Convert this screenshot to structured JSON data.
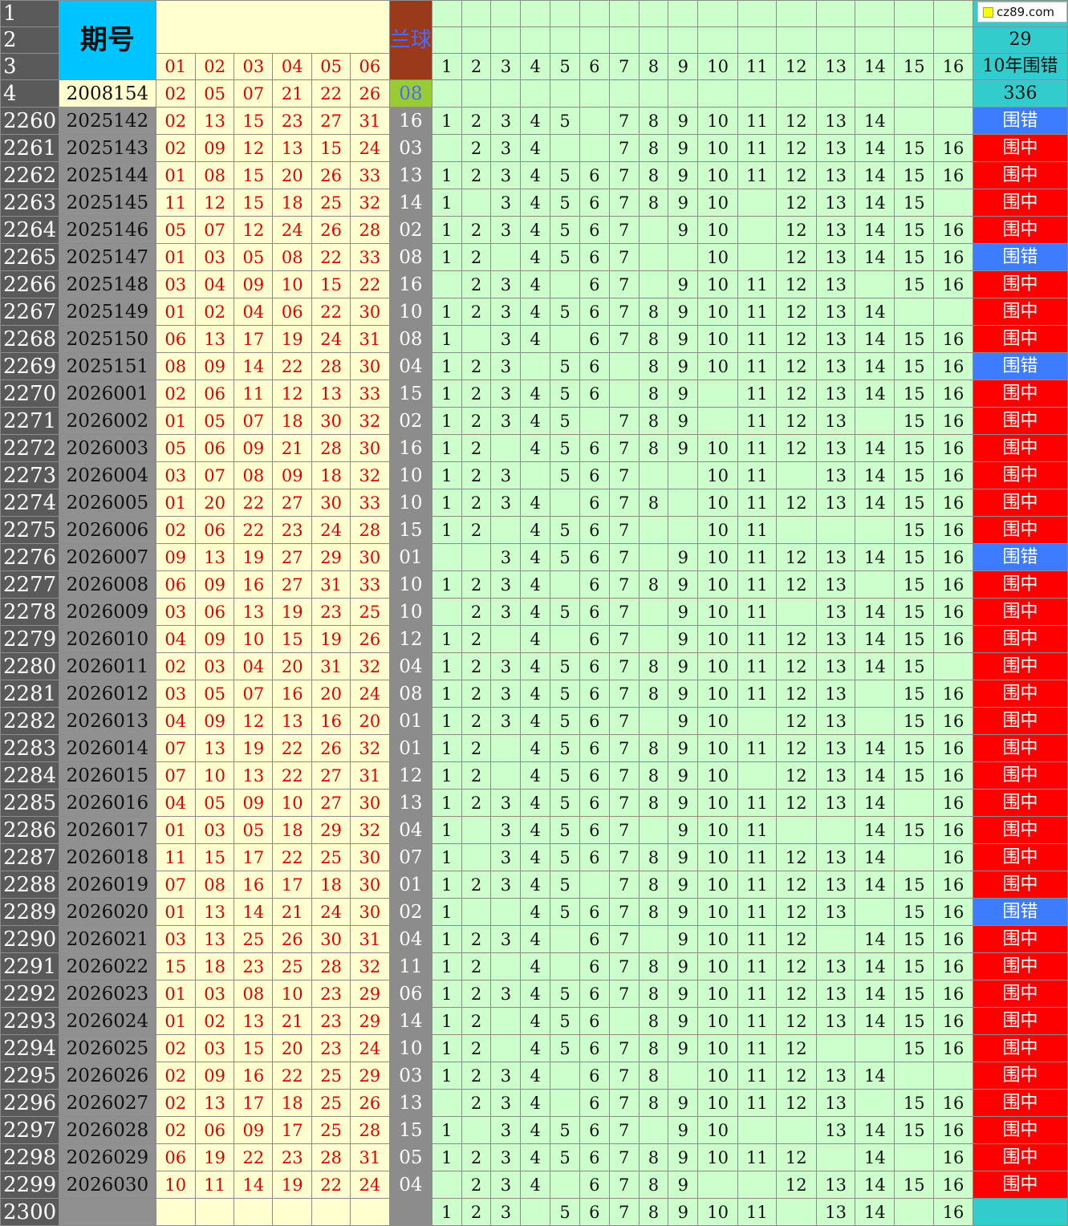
{
  "header": {
    "row_labels": [
      "1",
      "2",
      "3",
      "4"
    ],
    "qihao": "期号",
    "blue_label": "兰球",
    "red_cols": [
      "01",
      "02",
      "03",
      "04",
      "05",
      "06"
    ],
    "blue_digits": [
      "1",
      "2",
      "3",
      "4",
      "5",
      "6",
      "7",
      "8",
      "9",
      "10",
      "11",
      "12",
      "13",
      "14",
      "15",
      "16"
    ],
    "stat_row2": "29",
    "stat_row3": "10年围错",
    "first_issue": "2008154",
    "first_reds": [
      "02",
      "05",
      "07",
      "21",
      "22",
      "26"
    ],
    "first_blue": "08",
    "stat_row4": "336"
  },
  "watermark": "cz89.com",
  "colors": {
    "hit": "#ff0000",
    "miss": "#3d7bff",
    "stat": "#33cccc",
    "green": "#ccffcc",
    "yellow": "#ffffd0"
  },
  "rows": [
    {
      "n": "2260",
      "issue": "2025142",
      "reds": [
        "02",
        "13",
        "15",
        "23",
        "27",
        "31"
      ],
      "blue": "16",
      "digits": [
        "1",
        "2",
        "3",
        "4",
        "5",
        "",
        "7",
        "8",
        "9",
        "10",
        "11",
        "12",
        "13",
        "14",
        "",
        ""
      ],
      "result": "围错",
      "hit": false
    },
    {
      "n": "2261",
      "issue": "2025143",
      "reds": [
        "02",
        "09",
        "12",
        "13",
        "15",
        "24"
      ],
      "blue": "03",
      "digits": [
        "",
        "2",
        "3",
        "4",
        "",
        "",
        "7",
        "8",
        "9",
        "10",
        "11",
        "12",
        "13",
        "14",
        "15",
        "16"
      ],
      "result": "围中",
      "hit": true
    },
    {
      "n": "2262",
      "issue": "2025144",
      "reds": [
        "01",
        "08",
        "15",
        "20",
        "26",
        "33"
      ],
      "blue": "13",
      "digits": [
        "1",
        "2",
        "3",
        "4",
        "5",
        "6",
        "7",
        "8",
        "9",
        "10",
        "11",
        "12",
        "13",
        "14",
        "15",
        "16"
      ],
      "result": "围中",
      "hit": true
    },
    {
      "n": "2263",
      "issue": "2025145",
      "reds": [
        "11",
        "12",
        "15",
        "18",
        "25",
        "32"
      ],
      "blue": "14",
      "digits": [
        "1",
        "",
        "3",
        "4",
        "5",
        "6",
        "7",
        "8",
        "9",
        "10",
        "",
        "12",
        "13",
        "14",
        "15",
        ""
      ],
      "result": "围中",
      "hit": true
    },
    {
      "n": "2264",
      "issue": "2025146",
      "reds": [
        "05",
        "07",
        "12",
        "24",
        "26",
        "28"
      ],
      "blue": "02",
      "digits": [
        "1",
        "2",
        "3",
        "4",
        "5",
        "6",
        "7",
        "",
        "9",
        "10",
        "",
        "12",
        "13",
        "14",
        "15",
        "16"
      ],
      "result": "围中",
      "hit": true
    },
    {
      "n": "2265",
      "issue": "2025147",
      "reds": [
        "01",
        "03",
        "05",
        "08",
        "22",
        "33"
      ],
      "blue": "08",
      "digits": [
        "1",
        "2",
        "",
        "4",
        "5",
        "6",
        "7",
        "",
        "",
        "10",
        "",
        "12",
        "13",
        "14",
        "15",
        "16"
      ],
      "result": "围错",
      "hit": false
    },
    {
      "n": "2266",
      "issue": "2025148",
      "reds": [
        "03",
        "04",
        "09",
        "10",
        "15",
        "22"
      ],
      "blue": "16",
      "digits": [
        "",
        "2",
        "3",
        "4",
        "",
        "6",
        "7",
        "",
        "9",
        "10",
        "11",
        "12",
        "13",
        "",
        "15",
        "16"
      ],
      "result": "围中",
      "hit": true
    },
    {
      "n": "2267",
      "issue": "2025149",
      "reds": [
        "01",
        "02",
        "04",
        "06",
        "22",
        "30"
      ],
      "blue": "10",
      "digits": [
        "1",
        "2",
        "3",
        "4",
        "5",
        "6",
        "7",
        "8",
        "9",
        "10",
        "11",
        "12",
        "13",
        "14",
        "",
        ""
      ],
      "result": "围中",
      "hit": true
    },
    {
      "n": "2268",
      "issue": "2025150",
      "reds": [
        "06",
        "13",
        "17",
        "19",
        "24",
        "31"
      ],
      "blue": "08",
      "digits": [
        "1",
        "",
        "3",
        "4",
        "",
        "6",
        "7",
        "8",
        "9",
        "10",
        "11",
        "12",
        "13",
        "14",
        "15",
        "16"
      ],
      "result": "围中",
      "hit": true
    },
    {
      "n": "2269",
      "issue": "2025151",
      "reds": [
        "08",
        "09",
        "14",
        "22",
        "28",
        "30"
      ],
      "blue": "04",
      "digits": [
        "1",
        "2",
        "3",
        "",
        "5",
        "6",
        "",
        "8",
        "9",
        "10",
        "11",
        "12",
        "13",
        "14",
        "15",
        "16"
      ],
      "result": "围错",
      "hit": false
    },
    {
      "n": "2270",
      "issue": "2026001",
      "reds": [
        "02",
        "06",
        "11",
        "12",
        "13",
        "33"
      ],
      "blue": "15",
      "digits": [
        "1",
        "2",
        "3",
        "4",
        "5",
        "6",
        "",
        "8",
        "9",
        "",
        "11",
        "12",
        "13",
        "14",
        "15",
        "16"
      ],
      "result": "围中",
      "hit": true
    },
    {
      "n": "2271",
      "issue": "2026002",
      "reds": [
        "01",
        "05",
        "07",
        "18",
        "30",
        "32"
      ],
      "blue": "02",
      "digits": [
        "1",
        "2",
        "3",
        "4",
        "5",
        "",
        "7",
        "8",
        "9",
        "",
        "11",
        "12",
        "13",
        "",
        "15",
        "16"
      ],
      "result": "围中",
      "hit": true
    },
    {
      "n": "2272",
      "issue": "2026003",
      "reds": [
        "05",
        "06",
        "09",
        "21",
        "28",
        "30"
      ],
      "blue": "16",
      "digits": [
        "1",
        "2",
        "",
        "4",
        "5",
        "6",
        "7",
        "8",
        "9",
        "10",
        "11",
        "12",
        "13",
        "14",
        "15",
        "16"
      ],
      "result": "围中",
      "hit": true
    },
    {
      "n": "2273",
      "issue": "2026004",
      "reds": [
        "03",
        "07",
        "08",
        "09",
        "18",
        "32"
      ],
      "blue": "10",
      "digits": [
        "1",
        "2",
        "3",
        "",
        "5",
        "6",
        "7",
        "",
        "",
        "10",
        "11",
        "",
        "13",
        "14",
        "15",
        "16"
      ],
      "result": "围中",
      "hit": true
    },
    {
      "n": "2274",
      "issue": "2026005",
      "reds": [
        "01",
        "20",
        "22",
        "27",
        "30",
        "33"
      ],
      "blue": "10",
      "digits": [
        "1",
        "2",
        "3",
        "4",
        "",
        "6",
        "7",
        "8",
        "",
        "10",
        "11",
        "12",
        "13",
        "14",
        "15",
        "16"
      ],
      "result": "围中",
      "hit": true
    },
    {
      "n": "2275",
      "issue": "2026006",
      "reds": [
        "02",
        "06",
        "22",
        "23",
        "24",
        "28"
      ],
      "blue": "15",
      "digits": [
        "1",
        "2",
        "",
        "4",
        "5",
        "6",
        "7",
        "",
        "",
        "10",
        "11",
        "",
        "",
        "",
        "15",
        "16"
      ],
      "result": "围中",
      "hit": true
    },
    {
      "n": "2276",
      "issue": "2026007",
      "reds": [
        "09",
        "13",
        "19",
        "27",
        "29",
        "30"
      ],
      "blue": "01",
      "digits": [
        "",
        "",
        "3",
        "4",
        "5",
        "6",
        "7",
        "",
        "9",
        "10",
        "11",
        "12",
        "13",
        "14",
        "15",
        "16"
      ],
      "result": "围错",
      "hit": false
    },
    {
      "n": "2277",
      "issue": "2026008",
      "reds": [
        "06",
        "09",
        "16",
        "27",
        "31",
        "33"
      ],
      "blue": "10",
      "digits": [
        "1",
        "2",
        "3",
        "4",
        "",
        "6",
        "7",
        "8",
        "9",
        "10",
        "11",
        "12",
        "13",
        "",
        "15",
        "16"
      ],
      "result": "围中",
      "hit": true
    },
    {
      "n": "2278",
      "issue": "2026009",
      "reds": [
        "03",
        "06",
        "13",
        "19",
        "23",
        "25"
      ],
      "blue": "10",
      "digits": [
        "",
        "2",
        "3",
        "4",
        "5",
        "6",
        "7",
        "",
        "9",
        "10",
        "11",
        "",
        "13",
        "14",
        "15",
        "16"
      ],
      "result": "围中",
      "hit": true
    },
    {
      "n": "2279",
      "issue": "2026010",
      "reds": [
        "04",
        "09",
        "10",
        "15",
        "19",
        "26"
      ],
      "blue": "12",
      "digits": [
        "1",
        "2",
        "",
        "4",
        "",
        "6",
        "7",
        "",
        "9",
        "10",
        "11",
        "12",
        "13",
        "14",
        "15",
        "16"
      ],
      "result": "围中",
      "hit": true
    },
    {
      "n": "2280",
      "issue": "2026011",
      "reds": [
        "02",
        "03",
        "04",
        "20",
        "31",
        "32"
      ],
      "blue": "04",
      "digits": [
        "1",
        "2",
        "3",
        "4",
        "5",
        "6",
        "7",
        "8",
        "9",
        "10",
        "11",
        "12",
        "13",
        "14",
        "15",
        ""
      ],
      "result": "围中",
      "hit": true
    },
    {
      "n": "2281",
      "issue": "2026012",
      "reds": [
        "03",
        "05",
        "07",
        "16",
        "20",
        "24"
      ],
      "blue": "08",
      "digits": [
        "1",
        "2",
        "3",
        "4",
        "5",
        "6",
        "7",
        "8",
        "9",
        "10",
        "11",
        "12",
        "13",
        "",
        "15",
        "16"
      ],
      "result": "围中",
      "hit": true
    },
    {
      "n": "2282",
      "issue": "2026013",
      "reds": [
        "04",
        "09",
        "12",
        "13",
        "16",
        "20"
      ],
      "blue": "01",
      "digits": [
        "1",
        "2",
        "3",
        "4",
        "5",
        "6",
        "7",
        "",
        "9",
        "10",
        "",
        "12",
        "13",
        "",
        "15",
        "16"
      ],
      "result": "围中",
      "hit": true
    },
    {
      "n": "2283",
      "issue": "2026014",
      "reds": [
        "07",
        "13",
        "19",
        "22",
        "26",
        "32"
      ],
      "blue": "01",
      "digits": [
        "1",
        "2",
        "",
        "4",
        "5",
        "6",
        "7",
        "8",
        "9",
        "10",
        "11",
        "12",
        "13",
        "14",
        "15",
        "16"
      ],
      "result": "围中",
      "hit": true
    },
    {
      "n": "2284",
      "issue": "2026015",
      "reds": [
        "07",
        "10",
        "13",
        "22",
        "27",
        "31"
      ],
      "blue": "12",
      "digits": [
        "1",
        "2",
        "",
        "4",
        "5",
        "6",
        "7",
        "8",
        "9",
        "10",
        "",
        "12",
        "13",
        "14",
        "15",
        "16"
      ],
      "result": "围中",
      "hit": true
    },
    {
      "n": "2285",
      "issue": "2026016",
      "reds": [
        "04",
        "05",
        "09",
        "10",
        "27",
        "30"
      ],
      "blue": "13",
      "digits": [
        "1",
        "2",
        "3",
        "4",
        "5",
        "6",
        "7",
        "8",
        "9",
        "10",
        "11",
        "12",
        "13",
        "14",
        "",
        "16"
      ],
      "result": "围中",
      "hit": true
    },
    {
      "n": "2286",
      "issue": "2026017",
      "reds": [
        "01",
        "03",
        "05",
        "18",
        "29",
        "32"
      ],
      "blue": "04",
      "digits": [
        "1",
        "",
        "3",
        "4",
        "5",
        "6",
        "7",
        "",
        "9",
        "10",
        "11",
        "",
        "",
        "14",
        "15",
        "16"
      ],
      "result": "围中",
      "hit": true
    },
    {
      "n": "2287",
      "issue": "2026018",
      "reds": [
        "11",
        "15",
        "17",
        "22",
        "25",
        "30"
      ],
      "blue": "07",
      "digits": [
        "1",
        "",
        "3",
        "4",
        "5",
        "6",
        "7",
        "8",
        "9",
        "10",
        "11",
        "12",
        "13",
        "14",
        "",
        "16"
      ],
      "result": "围中",
      "hit": true
    },
    {
      "n": "2288",
      "issue": "2026019",
      "reds": [
        "07",
        "08",
        "16",
        "17",
        "18",
        "30"
      ],
      "blue": "01",
      "digits": [
        "1",
        "2",
        "3",
        "4",
        "5",
        "",
        "7",
        "8",
        "9",
        "10",
        "11",
        "12",
        "13",
        "14",
        "15",
        "16"
      ],
      "result": "围中",
      "hit": true
    },
    {
      "n": "2289",
      "issue": "2026020",
      "reds": [
        "01",
        "13",
        "14",
        "21",
        "24",
        "30"
      ],
      "blue": "02",
      "digits": [
        "1",
        "",
        "",
        "4",
        "5",
        "6",
        "7",
        "8",
        "9",
        "10",
        "11",
        "12",
        "13",
        "",
        "15",
        "16"
      ],
      "result": "围错",
      "hit": false
    },
    {
      "n": "2290",
      "issue": "2026021",
      "reds": [
        "03",
        "13",
        "25",
        "26",
        "30",
        "31"
      ],
      "blue": "04",
      "digits": [
        "1",
        "2",
        "3",
        "4",
        "",
        "6",
        "7",
        "",
        "9",
        "10",
        "11",
        "12",
        "",
        "14",
        "15",
        "16"
      ],
      "result": "围中",
      "hit": true
    },
    {
      "n": "2291",
      "issue": "2026022",
      "reds": [
        "15",
        "18",
        "23",
        "25",
        "28",
        "32"
      ],
      "blue": "11",
      "digits": [
        "1",
        "2",
        "",
        "4",
        "",
        "6",
        "7",
        "8",
        "9",
        "10",
        "11",
        "12",
        "13",
        "14",
        "15",
        "16"
      ],
      "result": "围中",
      "hit": true
    },
    {
      "n": "2292",
      "issue": "2026023",
      "reds": [
        "01",
        "03",
        "08",
        "10",
        "23",
        "29"
      ],
      "blue": "06",
      "digits": [
        "1",
        "2",
        "3",
        "4",
        "5",
        "6",
        "7",
        "8",
        "9",
        "10",
        "11",
        "12",
        "13",
        "14",
        "15",
        "16"
      ],
      "result": "围中",
      "hit": true
    },
    {
      "n": "2293",
      "issue": "2026024",
      "reds": [
        "01",
        "02",
        "13",
        "21",
        "23",
        "29"
      ],
      "blue": "14",
      "digits": [
        "1",
        "2",
        "",
        "4",
        "5",
        "6",
        "",
        "8",
        "9",
        "10",
        "11",
        "12",
        "13",
        "14",
        "15",
        "16"
      ],
      "result": "围中",
      "hit": true
    },
    {
      "n": "2294",
      "issue": "2026025",
      "reds": [
        "02",
        "03",
        "15",
        "20",
        "23",
        "24"
      ],
      "blue": "10",
      "digits": [
        "1",
        "2",
        "",
        "4",
        "5",
        "6",
        "7",
        "8",
        "9",
        "10",
        "11",
        "12",
        "",
        "",
        "15",
        "16"
      ],
      "result": "围中",
      "hit": true
    },
    {
      "n": "2295",
      "issue": "2026026",
      "reds": [
        "02",
        "09",
        "16",
        "22",
        "25",
        "29"
      ],
      "blue": "03",
      "digits": [
        "1",
        "2",
        "3",
        "4",
        "",
        "6",
        "7",
        "8",
        "",
        "10",
        "11",
        "12",
        "13",
        "14",
        "",
        ""
      ],
      "result": "围中",
      "hit": true
    },
    {
      "n": "2296",
      "issue": "2026027",
      "reds": [
        "02",
        "13",
        "17",
        "18",
        "25",
        "26"
      ],
      "blue": "13",
      "digits": [
        "",
        "2",
        "3",
        "4",
        "",
        "6",
        "7",
        "8",
        "9",
        "10",
        "11",
        "12",
        "13",
        "",
        "15",
        "16"
      ],
      "result": "围中",
      "hit": true
    },
    {
      "n": "2297",
      "issue": "2026028",
      "reds": [
        "02",
        "06",
        "09",
        "17",
        "25",
        "28"
      ],
      "blue": "15",
      "digits": [
        "1",
        "",
        "3",
        "4",
        "5",
        "6",
        "7",
        "",
        "9",
        "10",
        "",
        "",
        "13",
        "14",
        "15",
        "16"
      ],
      "result": "围中",
      "hit": true
    },
    {
      "n": "2298",
      "issue": "2026029",
      "reds": [
        "06",
        "19",
        "22",
        "23",
        "28",
        "31"
      ],
      "blue": "05",
      "digits": [
        "1",
        "2",
        "3",
        "4",
        "5",
        "6",
        "7",
        "8",
        "9",
        "10",
        "11",
        "12",
        "",
        "14",
        "",
        "16"
      ],
      "result": "围中",
      "hit": true
    },
    {
      "n": "2299",
      "issue": "2026030",
      "reds": [
        "10",
        "11",
        "14",
        "19",
        "22",
        "24"
      ],
      "blue": "04",
      "digits": [
        "",
        "2",
        "3",
        "4",
        "",
        "6",
        "7",
        "8",
        "9",
        "",
        "",
        "12",
        "13",
        "14",
        "15",
        "16"
      ],
      "result": "围中",
      "hit": true
    }
  ],
  "last_row": {
    "n": "2300",
    "digits": [
      "1",
      "2",
      "3",
      "",
      "5",
      "6",
      "7",
      "8",
      "9",
      "10",
      "11",
      "",
      "13",
      "14",
      "",
      "16"
    ]
  }
}
